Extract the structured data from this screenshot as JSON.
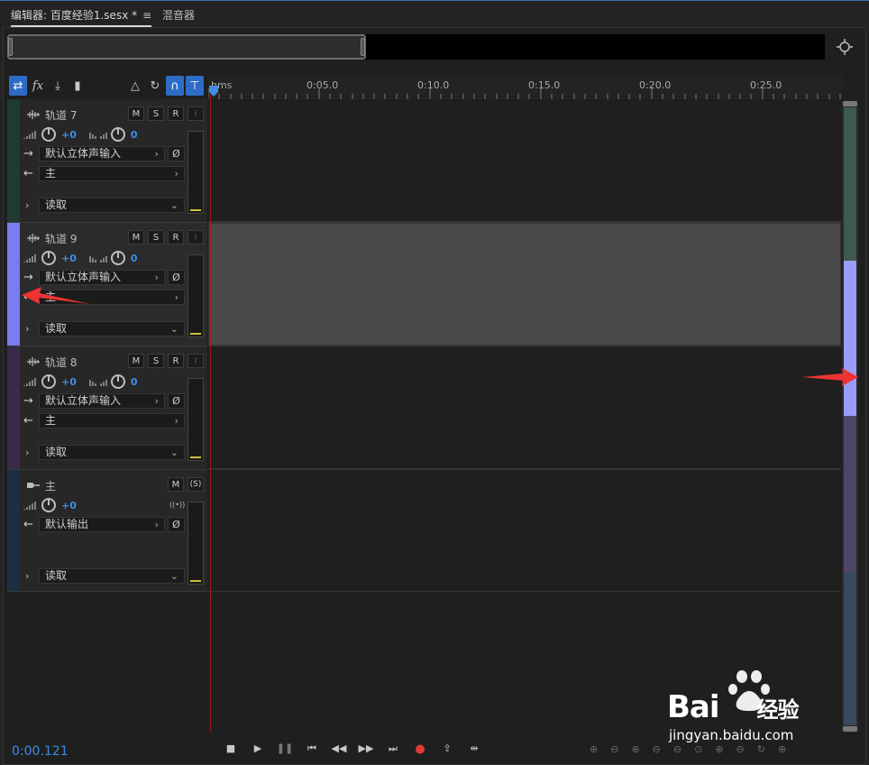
{
  "tabs": [
    {
      "label": "编辑器: 百度经验1.sesx *",
      "menu_icon": "hamburger-icon",
      "active": true
    },
    {
      "label": "混音器",
      "active": false
    }
  ],
  "ruler": {
    "labels": [
      "hms",
      "0:05.0",
      "0:10.0",
      "0:15.0",
      "0:20.0",
      "0:25.0"
    ]
  },
  "tracks": [
    {
      "name": "轨道 7",
      "volume": "+0",
      "pan": "0",
      "input": "默认立体声输入",
      "output": "主",
      "mode": "读取",
      "color": "#1f3b2f",
      "selected": false
    },
    {
      "name": "轨道 9",
      "volume": "+0",
      "pan": "0",
      "input": "默认立体声输入",
      "output": "主",
      "mode": "读取",
      "color": "#7b7bf0",
      "selected": true
    },
    {
      "name": "轨道 8",
      "volume": "+0",
      "pan": "0",
      "input": "默认立体声输入",
      "output": "主",
      "mode": "读取",
      "color": "#3a2a4a",
      "selected": false
    }
  ],
  "master": {
    "name": "主",
    "volume": "+0",
    "output": "默认输出",
    "mode": "读取",
    "color": "#1c2e42"
  },
  "buttons": {
    "mute": "M",
    "solo": "S",
    "record": "R",
    "input_monitor": "I",
    "solo_safe": "(S)",
    "phase": "Ø"
  },
  "transport": {
    "time": "0:00.121"
  },
  "scroll_segments": [
    {
      "color": "#3d5a4d",
      "fraction": 0.25
    },
    {
      "color": "#9b9bfa",
      "fraction": 0.25
    },
    {
      "color": "#4f4568",
      "fraction": 0.25
    },
    {
      "color": "#3a4a5e",
      "fraction": 0.25
    }
  ],
  "watermark": {
    "brand": "Bai",
    "brand2": "经验",
    "url": "jingyan.baidu.com"
  }
}
